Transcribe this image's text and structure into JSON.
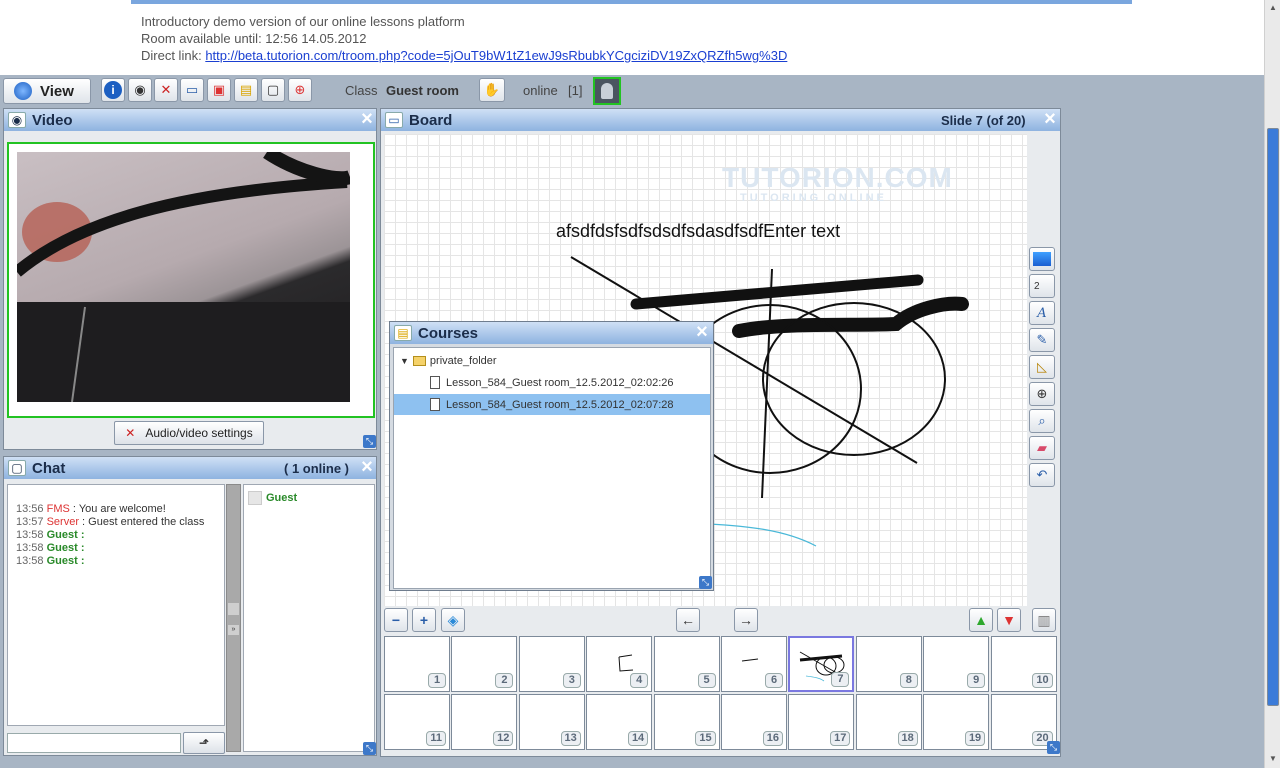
{
  "info": {
    "line1": "Introductory demo version of our online lessons platform",
    "line2": "Room available until: 12:56 14.05.2012",
    "direct_link_label": "Direct link:",
    "direct_link_url": "http://beta.tutorion.com/troom.php?code=5jOuT9bW1tZ1ewJ9sRbubkYCgciziDV19ZxQRZfh5wg%3D"
  },
  "toolbar": {
    "view_label": "View",
    "class_label": "Class",
    "class_name": "Guest room",
    "online_label": "online",
    "online_count": "[1]",
    "icons": [
      "info-icon",
      "webcam-icon",
      "settings-icon",
      "board-icon",
      "presentation-icon",
      "courses-icon",
      "chat-icon",
      "help-icon"
    ]
  },
  "video": {
    "title": "Video",
    "av_settings_label": "Audio/video settings"
  },
  "chat": {
    "title": "Chat",
    "online_status": "( 1 online )",
    "messages": [
      {
        "time": "13:56",
        "user": "FMS",
        "sep": " : ",
        "text": "You are welcome!",
        "kind": "system"
      },
      {
        "time": "13:57",
        "user": "Server",
        "sep": " : ",
        "text": "Guest entered the class",
        "kind": "system"
      },
      {
        "time": "13:58",
        "user": "Guest",
        "sep": " :",
        "text": "",
        "kind": "user"
      },
      {
        "time": "13:58",
        "user": "Guest",
        "sep": " :",
        "text": "",
        "kind": "user"
      },
      {
        "time": "13:58",
        "user": "Guest",
        "sep": " :",
        "text": "",
        "kind": "user"
      }
    ],
    "users": [
      "Guest"
    ],
    "input_placeholder": ""
  },
  "board": {
    "title": "Board",
    "slide_indicator": "Slide 7 (of 20)",
    "text_object": "afsdfdsfsdfsdsdfsdasdfsdfEnter text",
    "watermark": "TUTORION.COM",
    "watermark_sub": "TUTORING ONLINE",
    "line_width": "2",
    "tools": [
      "color-picker-icon",
      "line-width-icon",
      "text-tool-icon",
      "pen-tool-icon",
      "ruler-tool-icon",
      "compass-tool-icon",
      "zoom-tool-icon",
      "eraser-tool-icon",
      "undo-icon"
    ]
  },
  "courses": {
    "title": "Courses",
    "folder": "private_folder",
    "files": [
      {
        "name": "Lesson_584_Guest room_12.5.2012_02:02:26",
        "selected": false
      },
      {
        "name": "Lesson_584_Guest room_12.5.2012_02:07:28",
        "selected": true
      }
    ]
  },
  "slides": {
    "active": 7,
    "numbers": [
      "1",
      "2",
      "3",
      "4",
      "5",
      "6",
      "7",
      "8",
      "9",
      "10",
      "11",
      "12",
      "13",
      "14",
      "15",
      "16",
      "17",
      "18",
      "19",
      "20"
    ]
  },
  "colors": {
    "accent": "#3d78c9",
    "title_gradient_top": "#cfe0f5",
    "title_gradient_bottom": "#8eb3e0",
    "video_border": "#22c322",
    "selected_row": "#8ec1f0"
  }
}
